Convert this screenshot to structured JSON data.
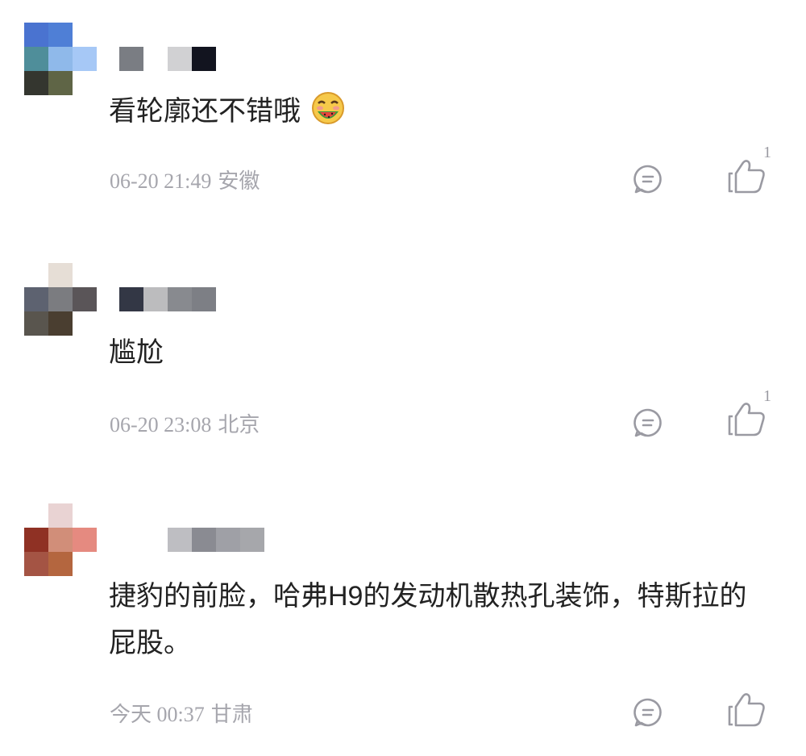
{
  "comments": [
    {
      "text": "看轮廓还不错哦",
      "emoji_icon": "watermelon-eating-face",
      "time": "06-20 21:49",
      "location": "安徽",
      "likes": "1"
    },
    {
      "text": "尴尬",
      "time": "06-20 23:08",
      "location": "北京",
      "likes": "1"
    },
    {
      "text": "捷豹的前脸，哈弗H9的发动机散热孔装饰，特斯拉的屁股。",
      "time": "今天 00:37",
      "location": "甘肃",
      "likes": ""
    }
  ],
  "icons": {
    "reply": "comment-icon",
    "like": "thumbs-up-icon"
  },
  "colors": {
    "text": "#222222",
    "meta": "#a6a6ad",
    "icon": "#9a9aa2"
  }
}
